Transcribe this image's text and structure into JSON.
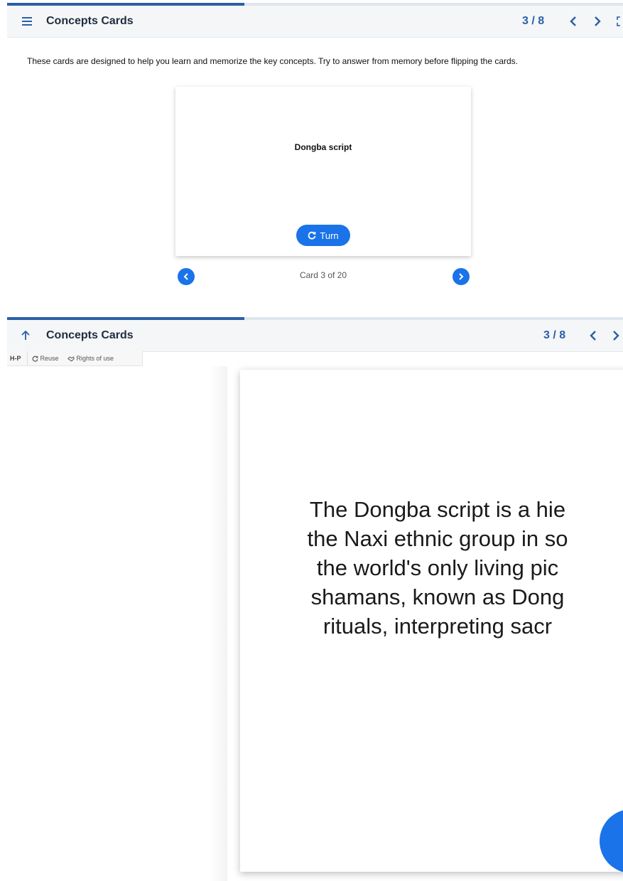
{
  "top": {
    "title": "Concepts Cards",
    "counter": "3 / 8",
    "intro": "These cards are designed to help you learn and memorize the key concepts. Try to answer from memory before flipping the cards.",
    "progress_fraction": 0.385,
    "card": {
      "front_text": "Dongba script",
      "turn_label": "Turn"
    },
    "card_counter": "Card 3 of 20",
    "icons": [
      "menu-icon",
      "chevron-left-icon",
      "chevron-right-icon",
      "fullscreen-icon",
      "refresh-icon"
    ]
  },
  "bottom": {
    "title": "Concepts Cards",
    "counter": "3 / 8",
    "progress_fraction": 0.385,
    "toolbar": {
      "h5p": "H-P",
      "reuse": "Reuse",
      "rights": "Rights of use"
    },
    "card_lines": [
      "The Dongba script is a hie",
      "the Naxi ethnic group in so",
      "the world's only living pic",
      "shamans, known as Dong",
      "rituals, interpreting sacr"
    ]
  },
  "colors": {
    "accent": "#2a5fa6",
    "button": "#1a73e8",
    "header_bg": "#f4f6f8"
  }
}
